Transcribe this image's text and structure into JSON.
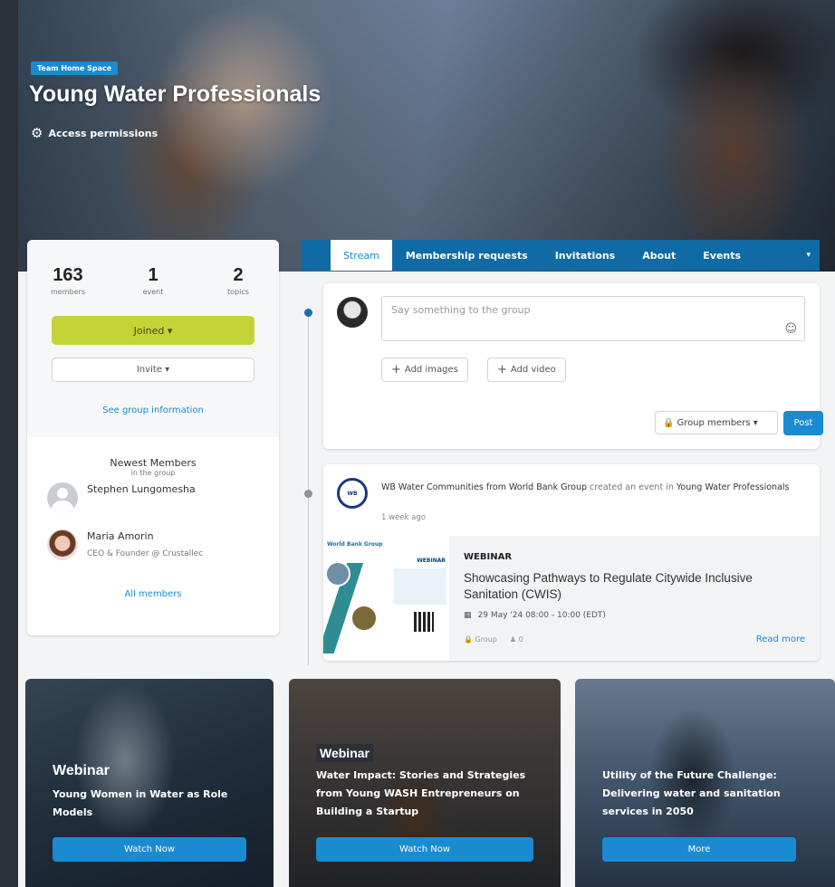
{
  "hero": {
    "tag": "Team Home Space",
    "title": "Young Water Professionals",
    "permissions_label": "Access permissions",
    "settings_icon": "gear-icon"
  },
  "stats": [
    {
      "value": "163",
      "label": "members"
    },
    {
      "value": "1",
      "label": "event"
    },
    {
      "value": "2",
      "label": "topics"
    }
  ],
  "left": {
    "joined_label": "Joined ▾",
    "invite_label": "Invite ▾",
    "see_info_label": "See group information",
    "newest_title": "Newest Members",
    "newest_sub": "in the group",
    "members": [
      {
        "name": "Stephen Lungomesha",
        "role": ""
      },
      {
        "name": "Maria Amorin",
        "role": "CEO & Founder @ Crustallec"
      }
    ],
    "all_members_label": "All members"
  },
  "tabs": {
    "items": [
      "Stream",
      "Membership requests",
      "Invitations",
      "About",
      "Events"
    ],
    "caret": "▾"
  },
  "composer": {
    "placeholder": "Say something to the group",
    "emoji": "☺",
    "add_images": "Add images",
    "add_video": "Add video",
    "plus": "+",
    "audience_label": "Group members ▾",
    "lock": "🔒",
    "post_label": "Post"
  },
  "event_post": {
    "logo_text": "WB",
    "author": "WB Water Communities from World Bank Group",
    "action": " created an event in ",
    "group": "Young Water Professionals",
    "time": "1 week ago",
    "thumb_header": "World Bank Group",
    "thumb_tag": "WEBINAR",
    "tag": "WEBINAR",
    "title": "Showcasing Pathways to Regulate Citywide Inclusive Sanitation (CWIS)",
    "calendar_icon": "▦",
    "date": "29 May '24 08:00 - 10:00 (EDT)",
    "visibility": "Group",
    "attendees": "0",
    "read_more": "Read more"
  },
  "promos": [
    {
      "label": "Webinar",
      "text": "Young Women in Water as Role Models",
      "button": "Watch Now"
    },
    {
      "label": "Webinar",
      "text": "Water Impact: Stories and Strategies from Young WASH Entrepreneurs on Building a Startup",
      "button": "Watch Now"
    },
    {
      "label": "",
      "text": "Utility of the Future Challenge: Delivering water and sanitation services in 2050",
      "button": "More"
    }
  ],
  "colors": {
    "accent": "#1a8ad1",
    "tab_bar": "#0f6aa6",
    "joined": "#c4d438",
    "background": "#f3f4f6"
  }
}
